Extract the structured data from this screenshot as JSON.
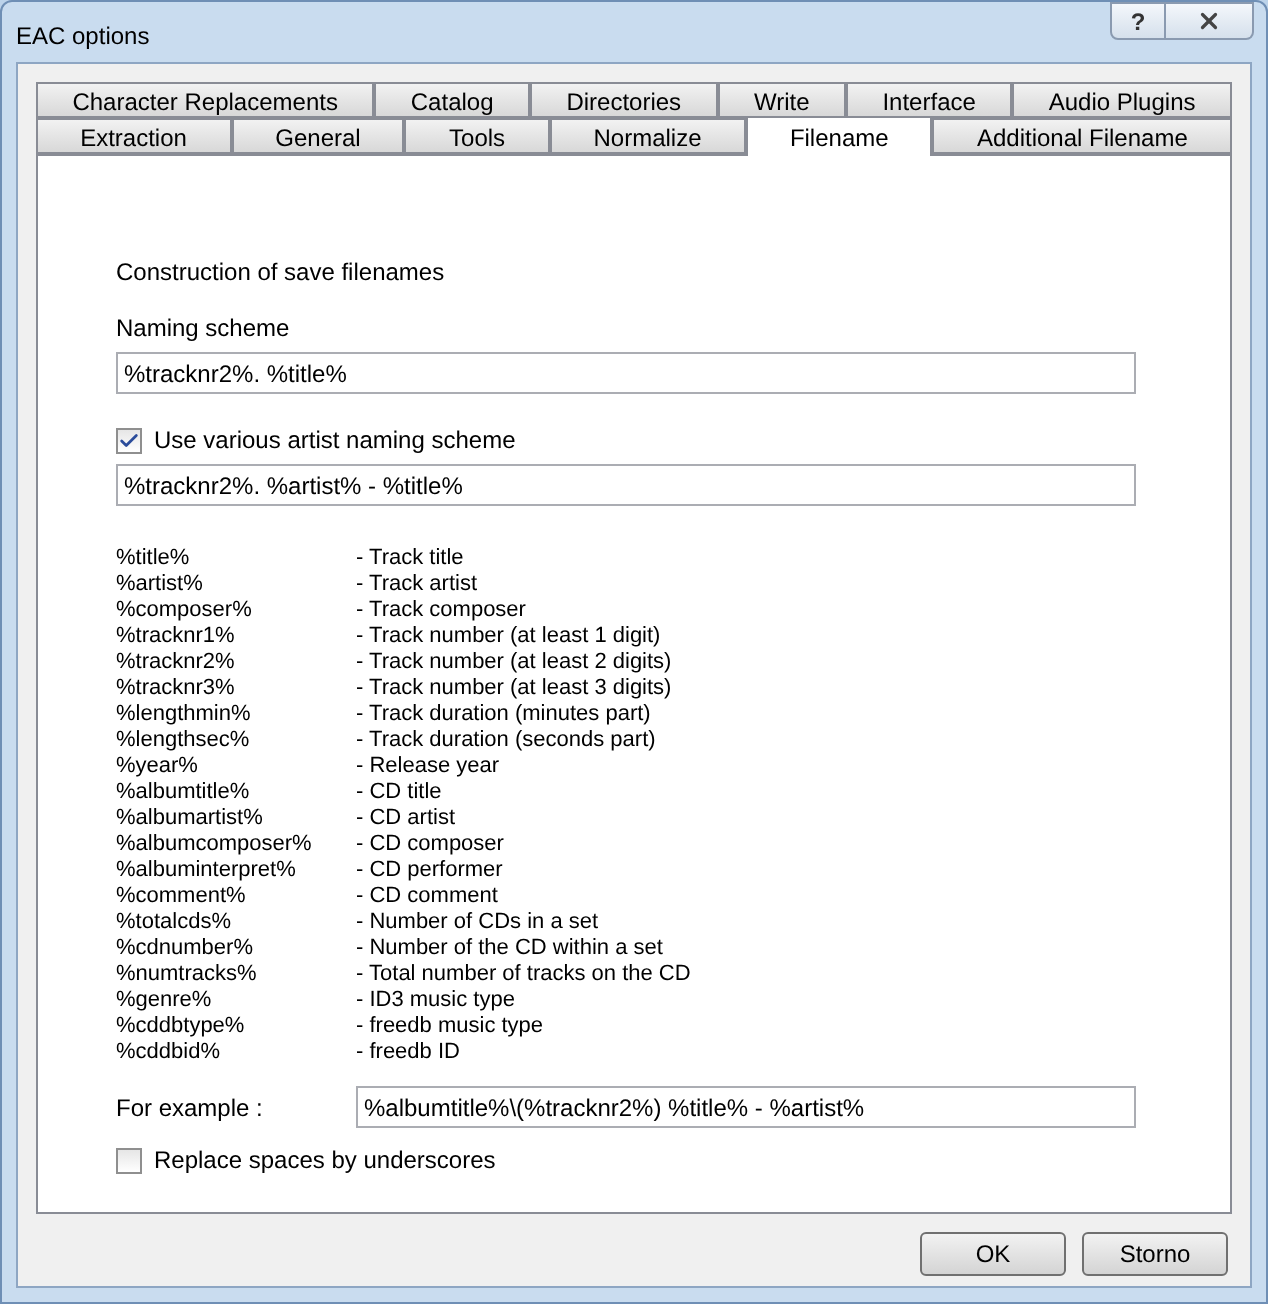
{
  "window": {
    "title": "EAC options",
    "help_button": "?"
  },
  "tab_rows": [
    [
      {
        "label": "Character Replacements",
        "selected": false
      },
      {
        "label": "Catalog",
        "selected": false
      },
      {
        "label": "Directories",
        "selected": false
      },
      {
        "label": "Write",
        "selected": false
      },
      {
        "label": "Interface",
        "selected": false
      },
      {
        "label": "Audio Plugins",
        "selected": false
      }
    ],
    [
      {
        "label": "Extraction",
        "selected": false
      },
      {
        "label": "General",
        "selected": false
      },
      {
        "label": "Tools",
        "selected": false
      },
      {
        "label": "Normalize",
        "selected": false
      },
      {
        "label": "Filename",
        "selected": true
      },
      {
        "label": "Additional Filename",
        "selected": false
      }
    ]
  ],
  "section_title": "Construction of save filenames",
  "naming_scheme": {
    "label": "Naming scheme",
    "value": "%tracknr2%. %title%"
  },
  "various_artist": {
    "label": "Use various artist naming scheme",
    "checked": true,
    "value": "%tracknr2%. %artist% - %title%"
  },
  "variables": [
    {
      "name": "%title%",
      "description": "- Track title"
    },
    {
      "name": "%artist%",
      "description": "- Track artist"
    },
    {
      "name": "%composer%",
      "description": "- Track composer"
    },
    {
      "name": "%tracknr1%",
      "description": "- Track number (at least 1 digit)"
    },
    {
      "name": "%tracknr2%",
      "description": "- Track number (at least 2 digits)"
    },
    {
      "name": "%tracknr3%",
      "description": "- Track number (at least 3 digits)"
    },
    {
      "name": "%lengthmin%",
      "description": "- Track duration (minutes part)"
    },
    {
      "name": "%lengthsec%",
      "description": "- Track duration (seconds part)"
    },
    {
      "name": "%year%",
      "description": "- Release year"
    },
    {
      "name": "%albumtitle%",
      "description": "- CD title"
    },
    {
      "name": "%albumartist%",
      "description": "- CD artist"
    },
    {
      "name": "%albumcomposer%",
      "description": "- CD composer"
    },
    {
      "name": "%albuminterpret%",
      "description": "- CD performer"
    },
    {
      "name": "%comment%",
      "description": "- CD comment"
    },
    {
      "name": "%totalcds%",
      "description": "- Number of CDs in a set"
    },
    {
      "name": "%cdnumber%",
      "description": "- Number of the CD within a set"
    },
    {
      "name": "%numtracks%",
      "description": "- Total number of tracks on the CD"
    },
    {
      "name": "%genre%",
      "description": "- ID3 music type"
    },
    {
      "name": "%cddbtype%",
      "description": "- freedb music type"
    },
    {
      "name": "%cddbid%",
      "description": "- freedb ID"
    }
  ],
  "example": {
    "label": "For example :",
    "value": "%albumtitle%\\(%tracknr2%) %title% - %artist%"
  },
  "replace_spaces": {
    "label": "Replace spaces by underscores",
    "checked": false
  },
  "buttons": [
    "OK",
    "Storno"
  ]
}
